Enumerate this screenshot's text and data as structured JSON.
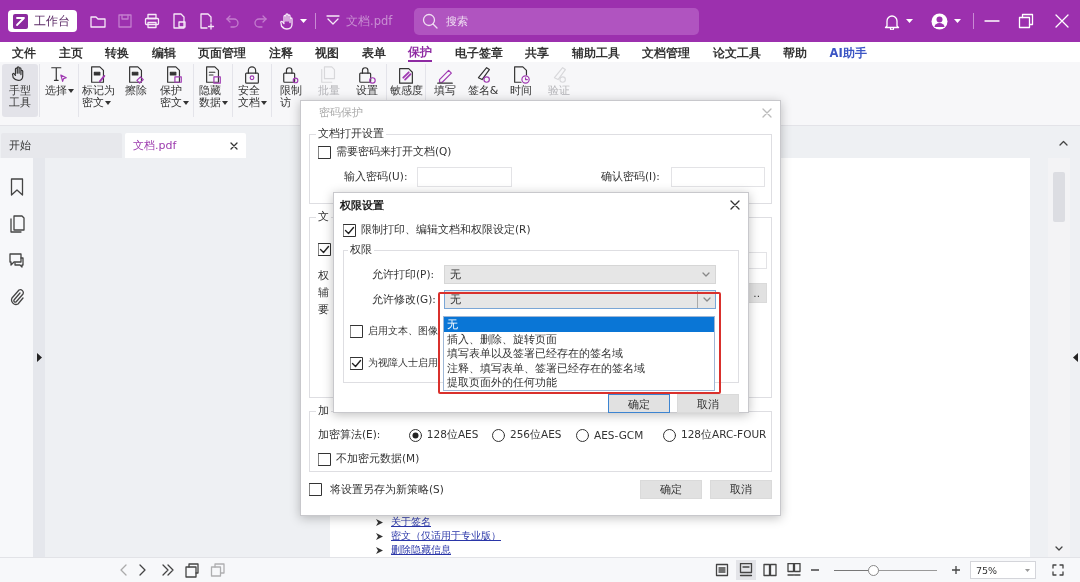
{
  "title_bar": {
    "workbench": "工作台",
    "document_title": "文档.pdf",
    "search_placeholder": "搜索"
  },
  "menu": [
    {
      "label": "文件",
      "selected": false,
      "kind": "plain"
    },
    {
      "label": "主页",
      "selected": false,
      "kind": "plain"
    },
    {
      "label": "转换",
      "selected": false,
      "kind": "plain"
    },
    {
      "label": "编辑",
      "selected": false,
      "kind": "plain"
    },
    {
      "label": "页面管理",
      "selected": false,
      "kind": "plain"
    },
    {
      "label": "注释",
      "selected": false,
      "kind": "plain"
    },
    {
      "label": "视图",
      "selected": false,
      "kind": "plain"
    },
    {
      "label": "表单",
      "selected": false,
      "kind": "plain"
    },
    {
      "label": "保护",
      "selected": true,
      "kind": "plain"
    },
    {
      "label": "电子签章",
      "selected": false,
      "kind": "plain"
    },
    {
      "label": "共享",
      "selected": false,
      "kind": "plain"
    },
    {
      "label": "辅助工具",
      "selected": false,
      "kind": "plain"
    },
    {
      "label": "文档管理",
      "selected": false,
      "kind": "plain"
    },
    {
      "label": "论文工具",
      "selected": false,
      "kind": "plain"
    },
    {
      "label": "帮助",
      "selected": false,
      "kind": "plain"
    },
    {
      "label": "AI助手",
      "selected": false,
      "kind": "ai"
    }
  ],
  "ribbon": [
    [
      {
        "kind": "hand",
        "lines": [
          "手型",
          "工具"
        ],
        "selected": true,
        "disabled": false,
        "has_menu": false
      }
    ],
    [
      {
        "kind": "select",
        "lines": [
          "选择"
        ],
        "selected": false,
        "disabled": false,
        "has_menu": true
      }
    ],
    [
      {
        "kind": "mark",
        "lines": [
          "标记为",
          "密文"
        ],
        "selected": false,
        "disabled": false,
        "has_menu": true
      },
      {
        "kind": "erase",
        "lines": [
          "擦除"
        ],
        "selected": false,
        "disabled": false,
        "has_menu": false
      },
      {
        "kind": "protect",
        "lines": [
          "保护",
          "密文"
        ],
        "selected": false,
        "disabled": false,
        "has_menu": true
      }
    ],
    [
      {
        "kind": "hide",
        "lines": [
          "隐藏",
          "数据"
        ],
        "selected": false,
        "disabled": false,
        "has_menu": true
      }
    ],
    [
      {
        "kind": "lock",
        "lines": [
          "安全",
          "文档"
        ],
        "selected": false,
        "disabled": false,
        "has_menu": true
      }
    ],
    [
      {
        "kind": "restrict",
        "lines": [
          "限制",
          "访"
        ],
        "selected": false,
        "disabled": false,
        "has_menu": false
      },
      {
        "kind": "batch",
        "lines": [
          "批量"
        ],
        "selected": false,
        "disabled": true,
        "has_menu": false
      },
      {
        "kind": "settings",
        "lines": [
          "设置"
        ],
        "selected": false,
        "disabled": false,
        "has_menu": false
      }
    ],
    [
      {
        "kind": "sensitivity",
        "lines": [
          "敏感度"
        ],
        "selected": false,
        "disabled": false,
        "has_menu": false
      }
    ],
    [
      {
        "kind": "fill",
        "lines": [
          "填写"
        ],
        "selected": false,
        "disabled": false,
        "has_menu": false
      },
      {
        "kind": "sign",
        "lines": [
          "签名&"
        ],
        "selected": false,
        "disabled": false,
        "has_menu": false
      },
      {
        "kind": "time",
        "lines": [
          "时间"
        ],
        "selected": false,
        "disabled": false,
        "has_menu": false
      },
      {
        "kind": "verify",
        "lines": [
          "验证"
        ],
        "selected": false,
        "disabled": true,
        "has_menu": false
      }
    ]
  ],
  "doc_tabs": [
    {
      "label": "开始",
      "selected": false,
      "closable": false
    },
    {
      "label": "文档.pdf",
      "selected": true,
      "closable": true
    }
  ],
  "document": {
    "links": [
      "关于签名",
      "密文（仅适用于专业版）",
      "删除隐藏信息"
    ]
  },
  "status_bar": {
    "zoom": {
      "level": 0.38
    },
    "zoom_value": "75%"
  },
  "password_dialog": {
    "title": "密码保护",
    "open_group": {
      "title": "文档打开设置",
      "require_password": {
        "label": "需要密码来打开文档(Q)",
        "checked": false
      },
      "password_label": "输入密码(U):",
      "confirm_label": "确认密码(I):"
    },
    "permission_group": {
      "title": "文",
      "restrict": {
        "checked": true
      },
      "fragments": [
        "权",
        "辅",
        "要"
      ],
      "more_button": ".."
    },
    "encryption_group": {
      "title": "加",
      "algorithm_label": "加密算法(E):",
      "algorithms": [
        {
          "label": "128位AES",
          "selected": true
        },
        {
          "label": "256位AES",
          "selected": false
        },
        {
          "label": "AES-GCM",
          "selected": false
        },
        {
          "label": "128位ARC-FOUR",
          "selected": false
        }
      ],
      "no_metadata": {
        "label": "不加密元数据(M)",
        "checked": false
      }
    },
    "save_policy": {
      "label": "将设置另存为新策略(S)",
      "checked": false
    },
    "buttons": [
      "确定",
      "取消"
    ]
  },
  "permission_dialog": {
    "title": "权限设置",
    "restrict": {
      "label": "限制打印、编辑文档和权限设定(R)",
      "checked": true
    },
    "group_title": "权限",
    "print": {
      "label": "允许打印(P):",
      "value": "无"
    },
    "modify": {
      "label": "允许修改(G):",
      "value": "无",
      "expanded": true,
      "options": [
        {
          "label": "无",
          "selected": true
        },
        {
          "label": "插入、删除、旋转页面",
          "selected": false
        },
        {
          "label": "填写表单以及签署已经存在的签名域",
          "selected": false
        },
        {
          "label": "注释、填写表单、签署已经存在的签名域",
          "selected": false
        },
        {
          "label": "提取页面外的任何功能",
          "selected": false
        }
      ]
    },
    "enable_copy": {
      "label": "启用文本、图像",
      "checked": false
    },
    "screen_reader": {
      "label": "为视障人士启用",
      "checked": true
    },
    "buttons": [
      "确定",
      "取消"
    ]
  }
}
